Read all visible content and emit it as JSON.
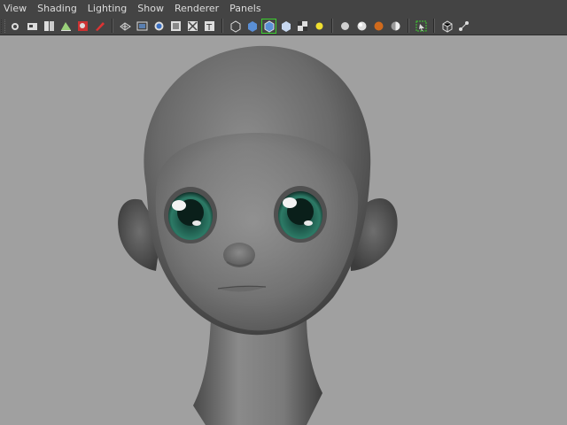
{
  "menu": {
    "items": [
      {
        "label": "View"
      },
      {
        "label": "Shading"
      },
      {
        "label": "Lighting"
      },
      {
        "label": "Show"
      },
      {
        "label": "Renderer"
      },
      {
        "label": "Panels"
      }
    ]
  },
  "toolbar": {
    "groups": [
      [
        "select-camera-icon",
        "camera-attributes-icon",
        "bookmarks-icon",
        "image-plane-icon",
        "two-d-pan-zoom-icon",
        "grease-pencil-icon"
      ],
      [
        "grid-icon",
        "film-gate-icon",
        "resolution-gate-icon",
        "gate-mask-icon",
        "field-chart-icon",
        "safe-title-icon"
      ],
      [
        "wireframe-icon",
        "smooth-shade-icon",
        "wireframe-on-shaded-icon",
        "default-material-icon",
        "textured-icon",
        "lights-icon"
      ],
      [
        "shadows-icon",
        "screen-space-ao-icon",
        "motion-blur-icon",
        "anti-aliasing-icon"
      ],
      [
        "isolate-select-icon"
      ],
      [
        "xray-icon",
        "xray-joints-icon"
      ]
    ],
    "active_icon": "wireframe-on-shaded-icon"
  },
  "colors": {
    "menubar_bg": "#444444",
    "viewport_bg": "#a0a0a0",
    "iris": "#2d7a66",
    "active_outline": "#3ccf2e"
  }
}
